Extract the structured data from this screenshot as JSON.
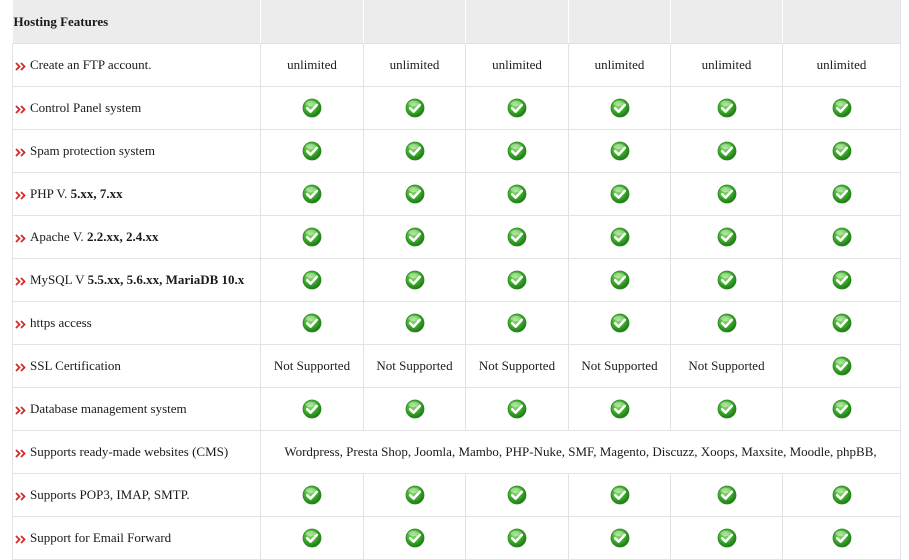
{
  "header": {
    "title": "Hosting Features"
  },
  "rows": {
    "ftp": {
      "label": "Create an FTP account.",
      "values": [
        "unlimited",
        "unlimited",
        "unlimited",
        "unlimited",
        "unlimited",
        "unlimited"
      ]
    },
    "cpanel": {
      "label": "Control Panel system"
    },
    "spam": {
      "label": "Spam protection system"
    },
    "php": {
      "label_prefix": "PHP V. ",
      "label_bold": "5.xx, 7.xx"
    },
    "apache": {
      "label_prefix": "Apache V. ",
      "label_bold": "2.2.xx, 2.4.xx"
    },
    "mysql": {
      "label_prefix": "MySQL V ",
      "label_bold": "5.5.xx, 5.6.xx, MariaDB 10.x"
    },
    "https": {
      "label": "https access"
    },
    "ssl": {
      "label": "SSL Certification",
      "values": [
        "Not Supported",
        "Not Supported",
        "Not Supported",
        "Not Supported",
        "Not Supported"
      ]
    },
    "db": {
      "label": "Database management system"
    },
    "cms": {
      "label": "Supports ready-made websites (CMS)",
      "value": "Wordpress, Presta Shop, Joomla, Mambo, PHP-Nuke, SMF, Magento, Discuzz, Xoops, Maxsite, Moodle, phpBB,"
    },
    "pop3": {
      "label": "Supports POP3, IMAP, SMTP."
    },
    "email": {
      "label": "Support for Email Forward"
    }
  },
  "icons": {
    "check": "check-circle-icon",
    "bullet": "double-arrow-icon"
  },
  "colors": {
    "check_green": "#3aa82b",
    "arrow_red": "#d42a2a",
    "header_bg": "#ececec"
  }
}
